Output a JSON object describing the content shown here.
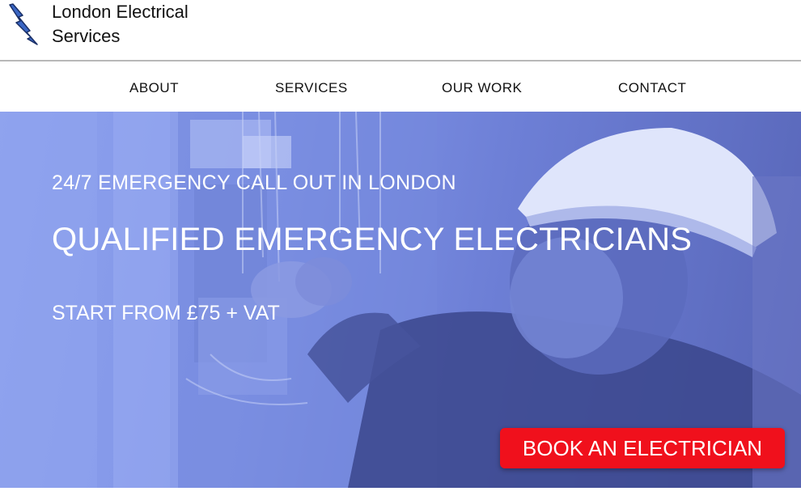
{
  "header": {
    "brand": "London Electrical\nServices",
    "logo_icon": "lightning-bolt-icon",
    "logo_color": "#3a66c4"
  },
  "nav": {
    "items": [
      {
        "label": "ABOUT"
      },
      {
        "label": "SERVICES"
      },
      {
        "label": "OUR WORK"
      },
      {
        "label": "CONTACT"
      }
    ]
  },
  "hero": {
    "subtitle": "24/7 EMERGENCY CALL OUT IN LONDON",
    "title": "QUALIFIED EMERGENCY ELECTRICIANS",
    "price": "START FROM £75 + VAT",
    "cta_label": "BOOK AN ELECTRICIAN",
    "cta_color": "#f0101c",
    "tint_color": "#7f93e6"
  }
}
